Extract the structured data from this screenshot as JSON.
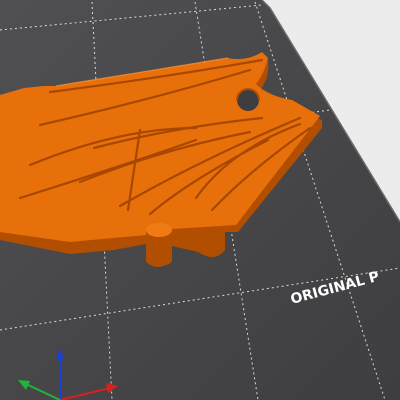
{
  "scene": {
    "bed_label": "ORIGINAL P",
    "colors": {
      "background": "#ececec",
      "bed": "#4a4a4c",
      "model": "#e8700b",
      "axis_x": "#d62121",
      "axis_y": "#1fb43a",
      "axis_z": "#1c3fd6"
    },
    "icons": {
      "model": "wooden-train-track-junction-model",
      "bed": "print-bed-plate",
      "axes": "xyz-axes-gizmo"
    }
  }
}
